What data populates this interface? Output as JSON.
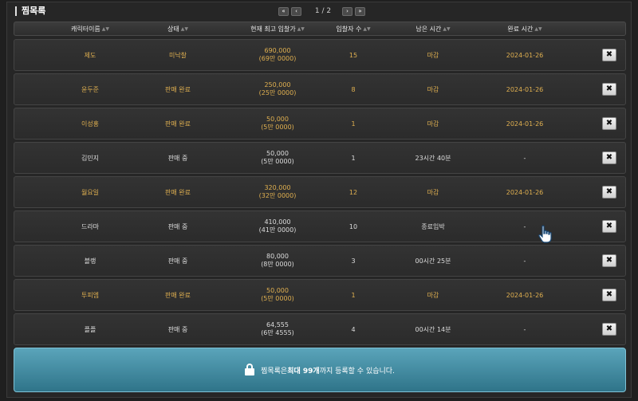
{
  "title": "찜목록",
  "pager": {
    "first_icon": "double-chevron-left-icon",
    "prev_icon": "chevron-left-icon",
    "next_icon": "chevron-right-icon",
    "last_icon": "double-chevron-right-icon",
    "text": "1 / 2"
  },
  "columns": [
    "캐릭터이름",
    "상태",
    "현재 최고 입찰가",
    "입찰자 수",
    "남은 시간",
    "완료 시간"
  ],
  "rows": [
    {
      "name": "제도",
      "status": "미낙찰",
      "price": "690,000",
      "price_sub": "(69만 0000)",
      "bidders": "15",
      "remaining": "마감",
      "completed": "2024-01-26",
      "done": true
    },
    {
      "name": "윤두준",
      "status": "판매 완료",
      "price": "250,000",
      "price_sub": "(25만 0000)",
      "bidders": "8",
      "remaining": "마감",
      "completed": "2024-01-26",
      "done": true
    },
    {
      "name": "이성홍",
      "status": "판매 완료",
      "price": "50,000",
      "price_sub": "(5만 0000)",
      "bidders": "1",
      "remaining": "마감",
      "completed": "2024-01-26",
      "done": true
    },
    {
      "name": "김민지",
      "status": "판매 중",
      "price": "50,000",
      "price_sub": "(5만 0000)",
      "bidders": "1",
      "remaining": "23시간 40분",
      "completed": "-",
      "done": false
    },
    {
      "name": "월요일",
      "status": "판매 완료",
      "price": "320,000",
      "price_sub": "(32만 0000)",
      "bidders": "12",
      "remaining": "마감",
      "completed": "2024-01-26",
      "done": true
    },
    {
      "name": "드라마",
      "status": "판매 중",
      "price": "410,000",
      "price_sub": "(41만 0000)",
      "bidders": "10",
      "remaining": "종료임박",
      "completed": "-",
      "done": false
    },
    {
      "name": "블랭",
      "status": "판매 중",
      "price": "80,000",
      "price_sub": "(8만 0000)",
      "bidders": "3",
      "remaining": "00시간 25분",
      "completed": "-",
      "done": false
    },
    {
      "name": "투피엠",
      "status": "판매 완료",
      "price": "50,000",
      "price_sub": "(5만 0000)",
      "bidders": "1",
      "remaining": "마감",
      "completed": "2024-01-26",
      "done": true
    },
    {
      "name": "플플",
      "status": "판매 중",
      "price": "64,555",
      "price_sub": "(6만 4555)",
      "bidders": "4",
      "remaining": "00시간 14분",
      "completed": "-",
      "done": false
    }
  ],
  "delete_label": "✖",
  "notice": {
    "icon": "lock-icon",
    "prefix": "찜목록은 ",
    "bold": "최대 99개",
    "suffix": "까지 등록할 수 있습니다."
  },
  "colors": {
    "completed_text": "#e0b050",
    "notice_bg": "#3f8aa0"
  }
}
